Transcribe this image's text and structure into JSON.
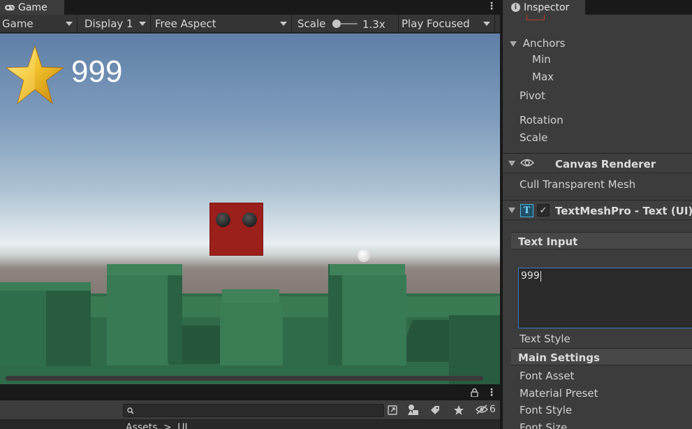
{
  "game": {
    "tab_label": "Game",
    "toolbar": {
      "mode_label": "Game",
      "display_label": "Display 1",
      "aspect_label": "Free Aspect",
      "scale_label": "Scale",
      "scale_value": "1.3x",
      "play_mode_label": "Play Focused"
    },
    "hud": {
      "coin_count": "999",
      "icon": "star-icon"
    }
  },
  "project": {
    "breadcrumb": [
      "Assets",
      ">",
      "UI"
    ],
    "hidden_count": "6",
    "icons": [
      "search-icon",
      "open-in-window-icon",
      "filter-type-icon",
      "tag-icon",
      "star-icon",
      "eye-hidden-icon"
    ]
  },
  "inspector": {
    "tab_label": "Inspector",
    "rect_transform": {
      "anchors_label": "Anchors",
      "min_label": "Min",
      "max_label": "Max",
      "pivot_label": "Pivot",
      "rotation_label": "Rotation",
      "scale_label": "Scale"
    },
    "canvas_renderer": {
      "title": "Canvas Renderer",
      "cull_label": "Cull Transparent Mesh"
    },
    "textmeshpro": {
      "title": "TextMeshPro - Text (UI)",
      "enabled": true,
      "text_input_label": "Text Input",
      "text_value": "999",
      "text_style_label": "Text Style",
      "main_settings_label": "Main Settings",
      "font_asset_label": "Font Asset",
      "material_preset_label": "Material Preset",
      "font_style_label": "Font Style",
      "font_size_label": "Font Size"
    }
  },
  "colors": {
    "editor_bg": "#3c3c3c",
    "dark_bg": "#191919",
    "accent_focus": "#3f79c0",
    "enemy_red": "#9b1f1b",
    "platform_green": "#3b7552"
  }
}
